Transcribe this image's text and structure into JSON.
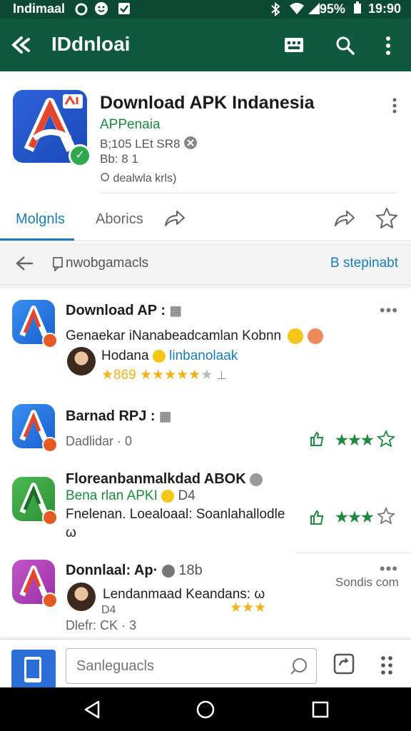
{
  "status_bar": {
    "carrier": "Indimaal",
    "battery": "95%",
    "time": "19:90"
  },
  "app_bar": {
    "title": "IDdnloai"
  },
  "app_header": {
    "title": "Download APK Indanesia",
    "developer": "APPenaia",
    "meta_line1": "B;105 LEt SR8 ",
    "meta_line2": "Bb: 8 1",
    "meta_line3": "dealwla krls)",
    "tabs": [
      "Molgnls",
      "Aborics"
    ]
  },
  "sub_bar": {
    "title": "nwobgamacls",
    "link": "B stepinabt"
  },
  "items": [
    {
      "title": "Download AP :",
      "line1": "Genaekar iNanabeadcamlan Kobnn",
      "reviewer": "Hodana",
      "reviewer_link": "linbanolaak",
      "rating": "★869"
    },
    {
      "title": "Barnad RPJ :",
      "subtitle": "Dadlidar · 0"
    },
    {
      "title": "Floreanbanmalkdad ABOK",
      "line1": "Bena rlan APKI",
      "line1_extra": "D4",
      "line2": "Fnelenan. Loealoaal: Soanlahallodle",
      "line3": "ω"
    },
    {
      "title": "Donnlaal: Ap·",
      "title_extra": "18b",
      "right_text": "Sondis com",
      "reviewer": "Lendanmaad Keandans: ω",
      "line2": "D4",
      "subtitle": "Dlefr: CK · 3"
    }
  ],
  "bottom_bar": {
    "search_placeholder": "Sanleguacls"
  },
  "colors": {
    "app_bar": "#0f5a3f",
    "accent": "#1a7dbb",
    "green": "#1f8a3e",
    "star": "#f2b31a"
  }
}
